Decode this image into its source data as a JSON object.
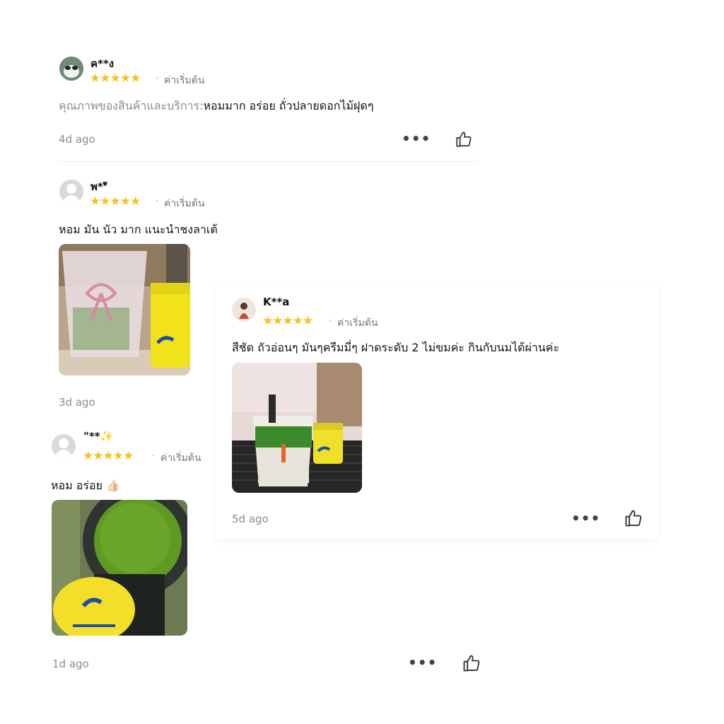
{
  "reviews": [
    {
      "username": "ค**ง",
      "stars": "★★★★★",
      "separator": "·",
      "variant": "ค่าเริ่มต้น",
      "text_label": "คุณภาพของสินค้าและบริการ:",
      "text": "หอมมาก อร่อย ถั่วปลายดอกไม้ฝุดๆ",
      "time": "4d ago",
      "more_icon": "more-icon",
      "like_icon": "thumb-up-icon"
    },
    {
      "username": "พ**ั",
      "stars": "★★★★★",
      "separator": "·",
      "variant": "ค่าเริ่มต้น",
      "text": "หอม มัน นัว มาก แนะนำชงลาเต้",
      "time": "3d ago"
    },
    {
      "username": "K**a",
      "stars": "★★★★★",
      "separator": "·",
      "variant": "ค่าเริ่มต้น",
      "text": "สีชัด ถัวอ่อนๆ มันๆครีมมี่ๆ ฝาดระดับ 2 ไม่ขมค่ะ กินกับนมได้ผ่านค่ะ",
      "time": "5d ago",
      "more_icon": "more-icon",
      "like_icon": "thumb-up-icon"
    },
    {
      "username": "\"**✨",
      "stars": "★★★★★",
      "separator": "·",
      "variant": "ค่าเริ่มต้น",
      "text": "หอม อร่อย 👍🏻",
      "time": "1d ago",
      "more_icon": "more-icon",
      "like_icon": "thumb-up-icon"
    }
  ],
  "more_label": "•••",
  "colors": {
    "star": "#f5c31b",
    "muted": "#8c8c8c"
  }
}
